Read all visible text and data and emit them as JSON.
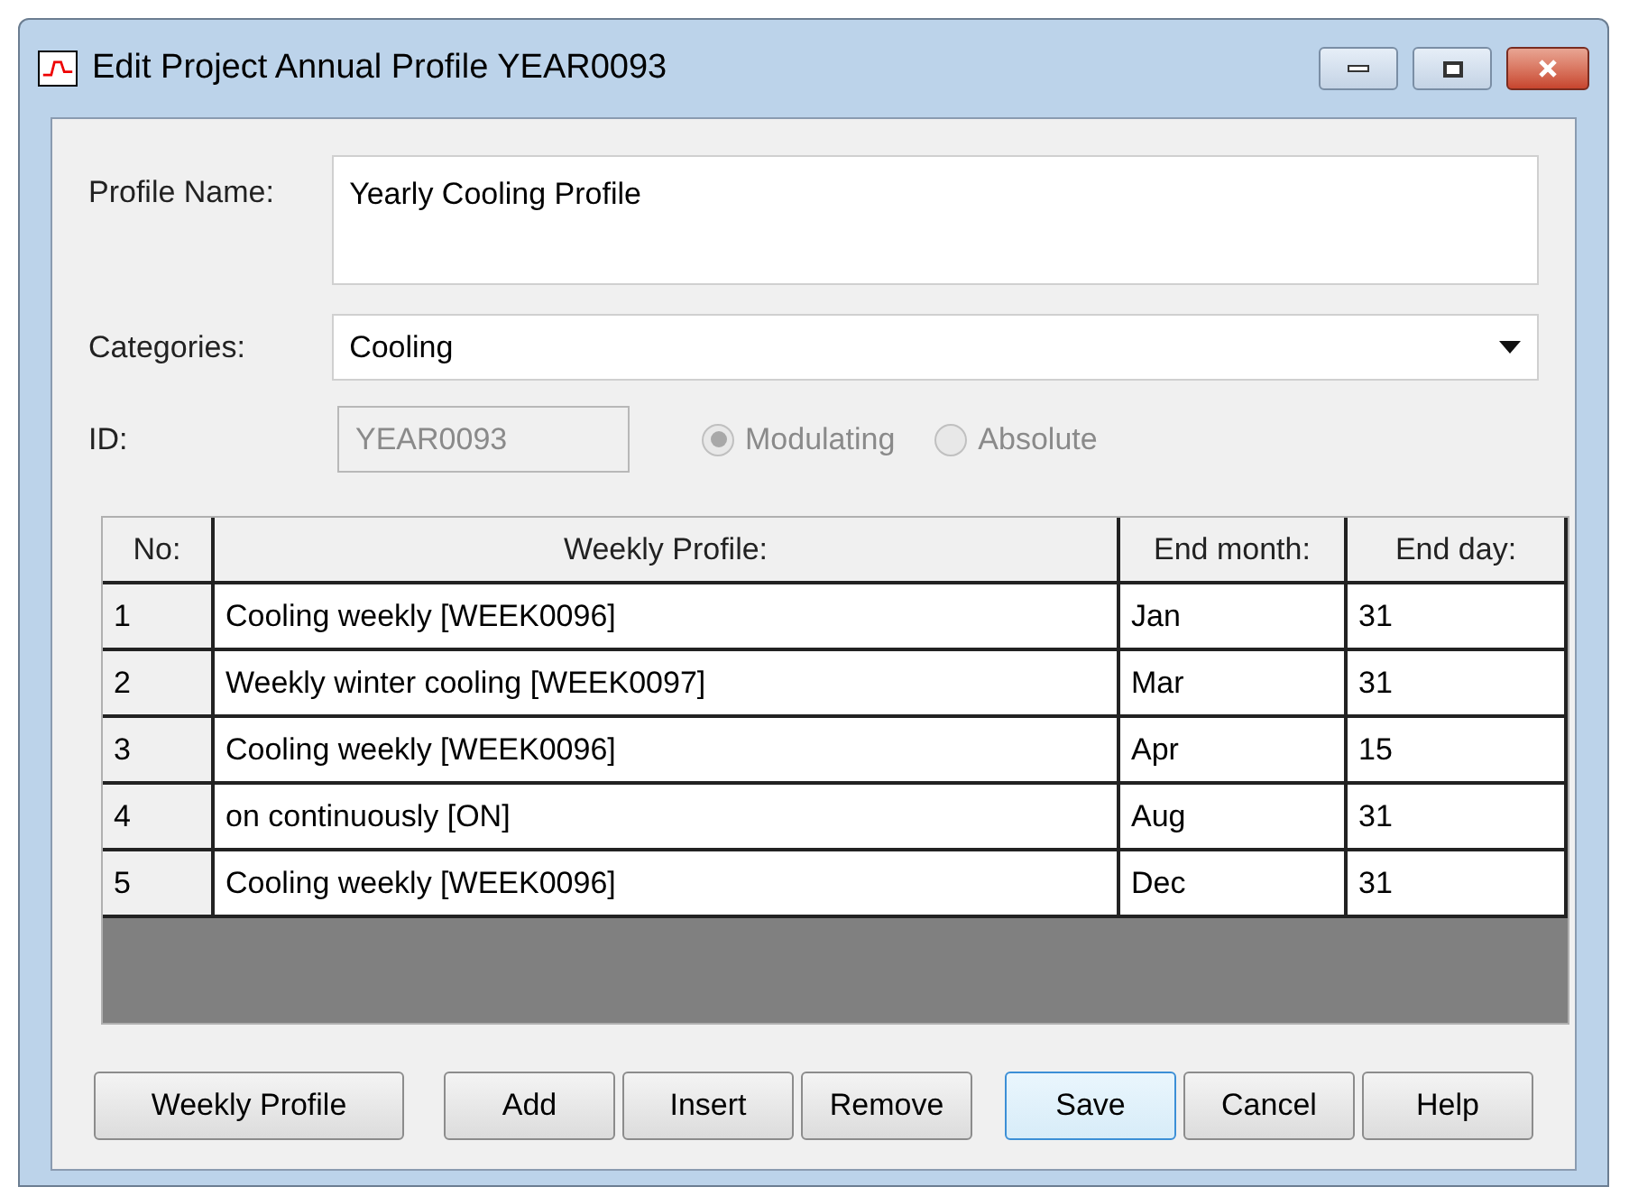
{
  "window": {
    "title": "Edit Project Annual Profile YEAR0093"
  },
  "profile_name": {
    "label": "Profile Name:",
    "value": "Yearly Cooling Profile"
  },
  "categories": {
    "label": "Categories:",
    "value": "Cooling"
  },
  "id": {
    "label": "ID:",
    "value": "YEAR0093",
    "disabled": true
  },
  "mode": [
    {
      "label": "Modulating",
      "selected": true,
      "disabled": true
    },
    {
      "label": "Absolute",
      "selected": false,
      "disabled": true
    }
  ],
  "table": {
    "columns": [
      "No:",
      "Weekly Profile:",
      "End month:",
      "End day:"
    ],
    "rows": [
      [
        "1",
        "Cooling weekly [WEEK0096]",
        "Jan",
        "31"
      ],
      [
        "2",
        "Weekly winter cooling [WEEK0097]",
        "Mar",
        "31"
      ],
      [
        "3",
        "Cooling weekly [WEEK0096]",
        "Apr",
        "15"
      ],
      [
        "4",
        "on continuously [ON]",
        "Aug",
        "31"
      ],
      [
        "5",
        "Cooling weekly [WEEK0096]",
        "Dec",
        "31"
      ]
    ]
  },
  "buttons": [
    {
      "label": "Weekly Profile",
      "default": false
    },
    {
      "label": "Add",
      "default": false
    },
    {
      "label": "Insert",
      "default": false
    },
    {
      "label": "Remove",
      "default": false
    },
    {
      "label": "Save",
      "default": true
    },
    {
      "label": "Cancel",
      "default": false
    },
    {
      "label": "Help",
      "default": false
    }
  ]
}
